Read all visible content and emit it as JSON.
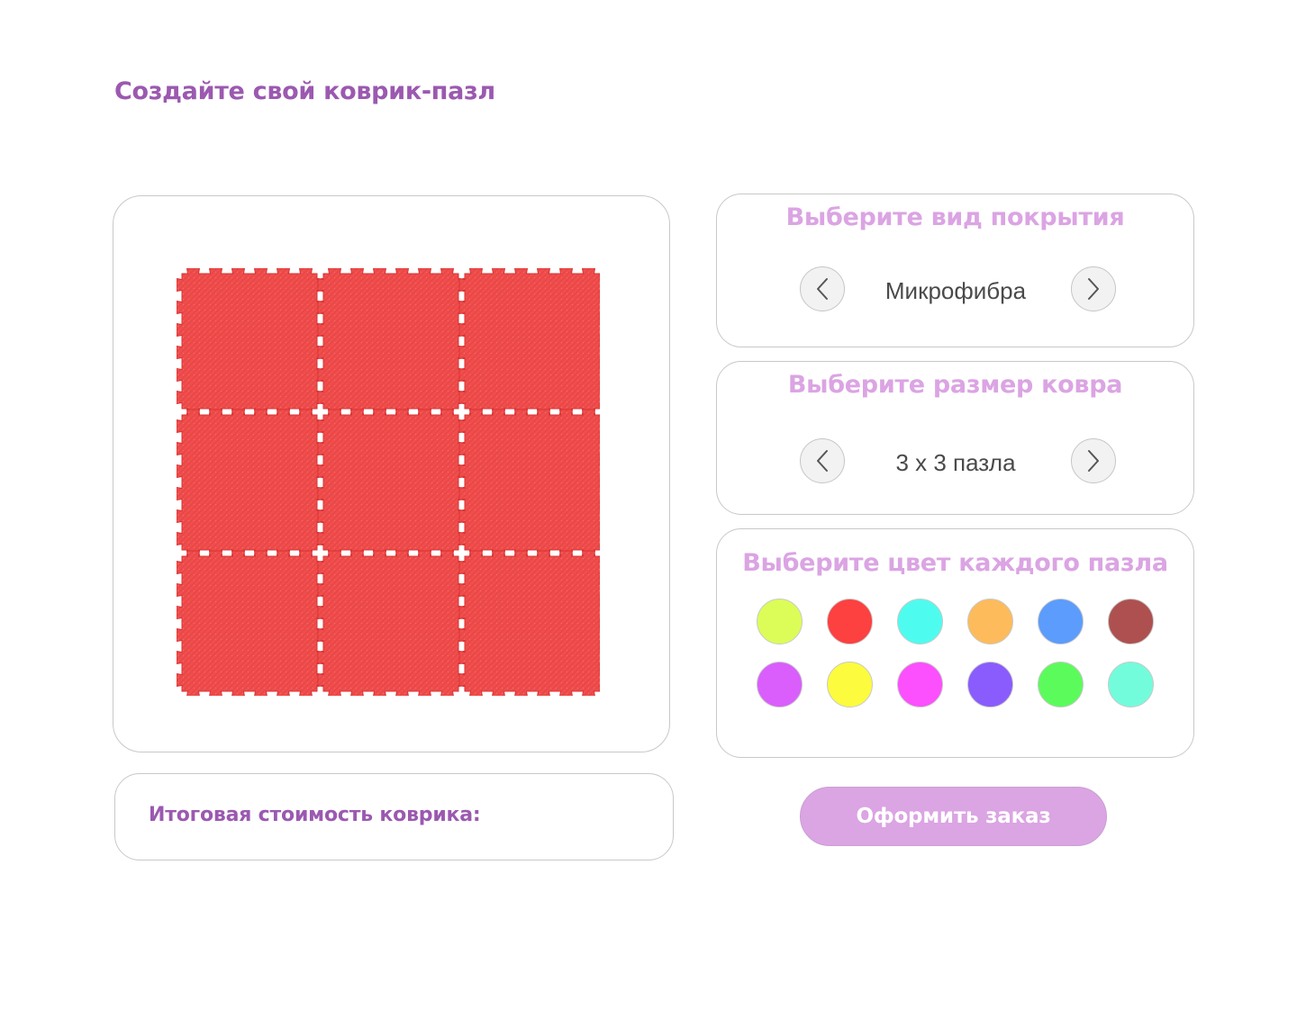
{
  "page": {
    "title": "Создайте свой коврик-пазл"
  },
  "preview": {
    "rows": 3,
    "cols": 3,
    "tile_color": "#f04d4d"
  },
  "total": {
    "label": "Итоговая стоимость коврика:"
  },
  "coverage": {
    "title": "Выберите вид покрытия",
    "value": "Микрофибра",
    "prev_icon": "chevron-left-icon",
    "next_icon": "chevron-right-icon"
  },
  "size": {
    "title": "Выберите размер ковра",
    "value": "3 x 3 пазла",
    "prev_icon": "chevron-left-icon",
    "next_icon": "chevron-right-icon"
  },
  "colors": {
    "title": "Выберите цвет каждого пазла",
    "swatches": [
      "#dcfd58",
      "#fd4040",
      "#4efcef",
      "#fdbb5c",
      "#5b9cfd",
      "#ae5050",
      "#d95efc",
      "#fcfb3e",
      "#fc4ffd",
      "#8a5cfd",
      "#5cfb5c",
      "#73fcdc"
    ]
  },
  "order": {
    "label": "Оформить заказ"
  }
}
